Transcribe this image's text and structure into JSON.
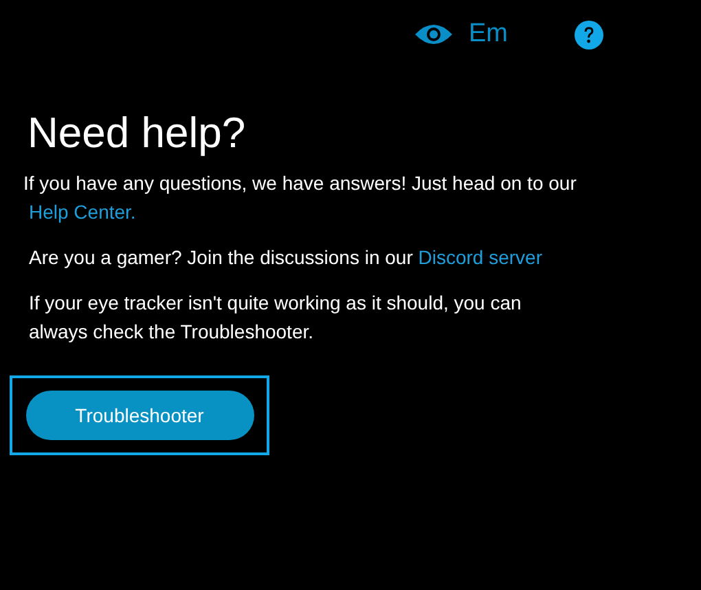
{
  "header": {
    "language": "Em"
  },
  "title": "Need help?",
  "paragraphs": [
    {
      "text": "If you have any questions, we have answers! Just head on to our",
      "link": "Help Center."
    },
    {
      "text": "Are you a gamer? Join the discussions in our",
      "link": "Discord server"
    },
    {
      "text": "If your eye tracker isn't quite working as it should, you can always check the Troubleshooter."
    }
  ],
  "button": {
    "label": "Troubleshooter",
    "focused": true
  }
}
